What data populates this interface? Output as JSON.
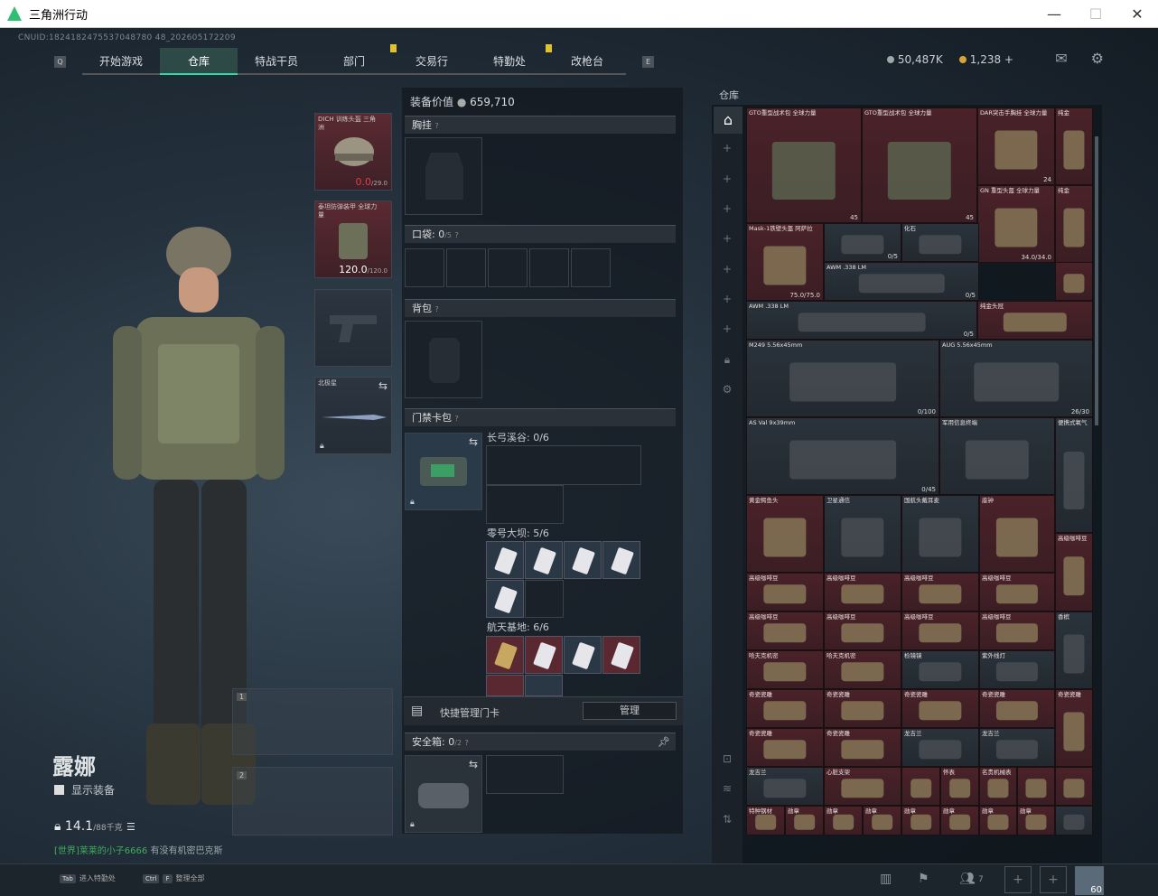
{
  "window": {
    "title": "三角洲行动"
  },
  "uid": "CNUID:1824182475537048780 48_202605172209",
  "nav": {
    "tabs": [
      {
        "label": "开始游戏",
        "active": false
      },
      {
        "label": "仓库",
        "active": true
      },
      {
        "label": "特战干员",
        "active": false
      },
      {
        "label": "部门",
        "active": false,
        "badge": true
      },
      {
        "label": "交易行",
        "active": false
      },
      {
        "label": "特勤处",
        "active": false,
        "badge": true
      },
      {
        "label": "改枪台",
        "active": false
      }
    ]
  },
  "currency": {
    "silver": "50,487K",
    "gold": "1,238 +"
  },
  "character": {
    "name": "露娜",
    "show_equipment": "显示装备",
    "weight": "14.1",
    "weight_max": "/88千克",
    "chat_prefix": "[世界]",
    "chat_user": "莱莱的小子6666",
    "chat_msg": "有没有机密巴克斯"
  },
  "gear": {
    "helmet": {
      "label": "DICH 训练头盔 三角洲",
      "durability": "0.0",
      "max": "/29.0"
    },
    "armor": {
      "label": "泰坦防弹装甲 全球力量",
      "durability": "120.0",
      "max": "/120.0"
    },
    "melee": {
      "label": "北极星"
    },
    "slot1": "1",
    "slot2": "2"
  },
  "equipment": {
    "value_label": "装备价值",
    "value": "659,710",
    "chest_rig": "胸挂",
    "pockets": "口袋:",
    "pockets_count": "0",
    "pockets_max": "/5",
    "backpack": "背包",
    "keycard_case": "门禁卡包",
    "keycards": [
      {
        "name": "长弓溪谷:",
        "count": "0/6"
      },
      {
        "name": "零号大坝:",
        "count": "5/6"
      },
      {
        "name": "航天基地:",
        "count": "6/6"
      }
    ],
    "quick_manage": "快捷管理门卡",
    "manage_button": "管理",
    "safe_box": "安全箱:",
    "safe_count": "0",
    "safe_max": "/2"
  },
  "warehouse": {
    "title": "仓库",
    "items": [
      {
        "name": "GTO重型战术包 全球力量",
        "count": "45"
      },
      {
        "name": "GTO重型战术包 全球力量",
        "count": "45"
      },
      {
        "name": "DAR突击手胸挂 全球力量",
        "count": "24"
      },
      {
        "name": "纯金",
        "count": ""
      },
      {
        "name": "GN 重型头盔 全球力量",
        "count": "34.0/34.0"
      },
      {
        "name": "纯金",
        "count": ""
      },
      {
        "name": "Mask-1铁壁头盔 阿萨拉",
        "count": "75.0/75.0"
      },
      {
        "name": "",
        "count": "0/5"
      },
      {
        "name": "化石",
        "count": ""
      },
      {
        "name": "AWM .338 LM",
        "count": "0/5"
      },
      {
        "name": "",
        "count": ""
      },
      {
        "name": "AWM .338 LM",
        "count": "0/5"
      },
      {
        "name": "纯金头冠",
        "count": ""
      },
      {
        "name": "M249 5.56x45mm",
        "count": "0/100"
      },
      {
        "name": "AUG 5.56x45mm",
        "count": "26/30"
      },
      {
        "name": "AS Val 9x39mm",
        "count": "0/45"
      },
      {
        "name": "军用信息终端",
        "count": ""
      },
      {
        "name": "便携式氧气",
        "count": ""
      },
      {
        "name": "黄金鳄鱼头",
        "count": ""
      },
      {
        "name": "卫星通信",
        "count": ""
      },
      {
        "name": "国航头戴耳麦",
        "count": ""
      },
      {
        "name": "座钟",
        "count": ""
      },
      {
        "name": "高级咖啡豆",
        "count": ""
      },
      {
        "name": "高级咖啡豆",
        "count": ""
      },
      {
        "name": "高级咖啡豆",
        "count": ""
      },
      {
        "name": "高级咖啡豆",
        "count": ""
      },
      {
        "name": "高级咖啡豆",
        "count": ""
      },
      {
        "name": "高级咖啡豆",
        "count": ""
      },
      {
        "name": "高级咖啡豆",
        "count": ""
      },
      {
        "name": "高级咖啡豆",
        "count": ""
      },
      {
        "name": "高级咖啡豆",
        "count": ""
      },
      {
        "name": "香槟",
        "count": ""
      },
      {
        "name": "哈夫克机密",
        "count": ""
      },
      {
        "name": "哈夫克机密",
        "count": ""
      },
      {
        "name": "检镜镜",
        "count": ""
      },
      {
        "name": "紫外线灯",
        "count": ""
      },
      {
        "name": "奇瓷瓷雕",
        "count": ""
      },
      {
        "name": "奇瓷瓷雕",
        "count": ""
      },
      {
        "name": "奇瓷瓷雕",
        "count": ""
      },
      {
        "name": "奇瓷瓷雕",
        "count": ""
      },
      {
        "name": "奇瓷瓷雕",
        "count": ""
      },
      {
        "name": "奇瓷瓷雕",
        "count": ""
      },
      {
        "name": "奇瓷瓷雕",
        "count": ""
      },
      {
        "name": "龙吉兰",
        "count": ""
      },
      {
        "name": "龙吉兰",
        "count": ""
      },
      {
        "name": "龙吉兰",
        "count": ""
      },
      {
        "name": "心脏支架",
        "count": ""
      },
      {
        "name": "",
        "count": ""
      },
      {
        "name": "怀表",
        "count": ""
      },
      {
        "name": "名贵机械表",
        "count": ""
      },
      {
        "name": "",
        "count": ""
      },
      {
        "name": "",
        "count": ""
      },
      {
        "name": "特种钢材",
        "count": ""
      },
      {
        "name": "勋章",
        "count": ""
      },
      {
        "name": "勋章",
        "count": ""
      },
      {
        "name": "勋章",
        "count": ""
      },
      {
        "name": "勋章",
        "count": ""
      },
      {
        "name": "勋章",
        "count": ""
      },
      {
        "name": "勋章",
        "count": ""
      },
      {
        "name": "勋章",
        "count": ""
      },
      {
        "name": "",
        "count": ""
      }
    ]
  },
  "bottom": {
    "tab_key": "Tab",
    "tab_action": "进入特勤处",
    "ctrl_key": "Ctrl",
    "f_key": "F",
    "ctrl_action": "整理全部",
    "friends_count": "7",
    "level": "60"
  }
}
